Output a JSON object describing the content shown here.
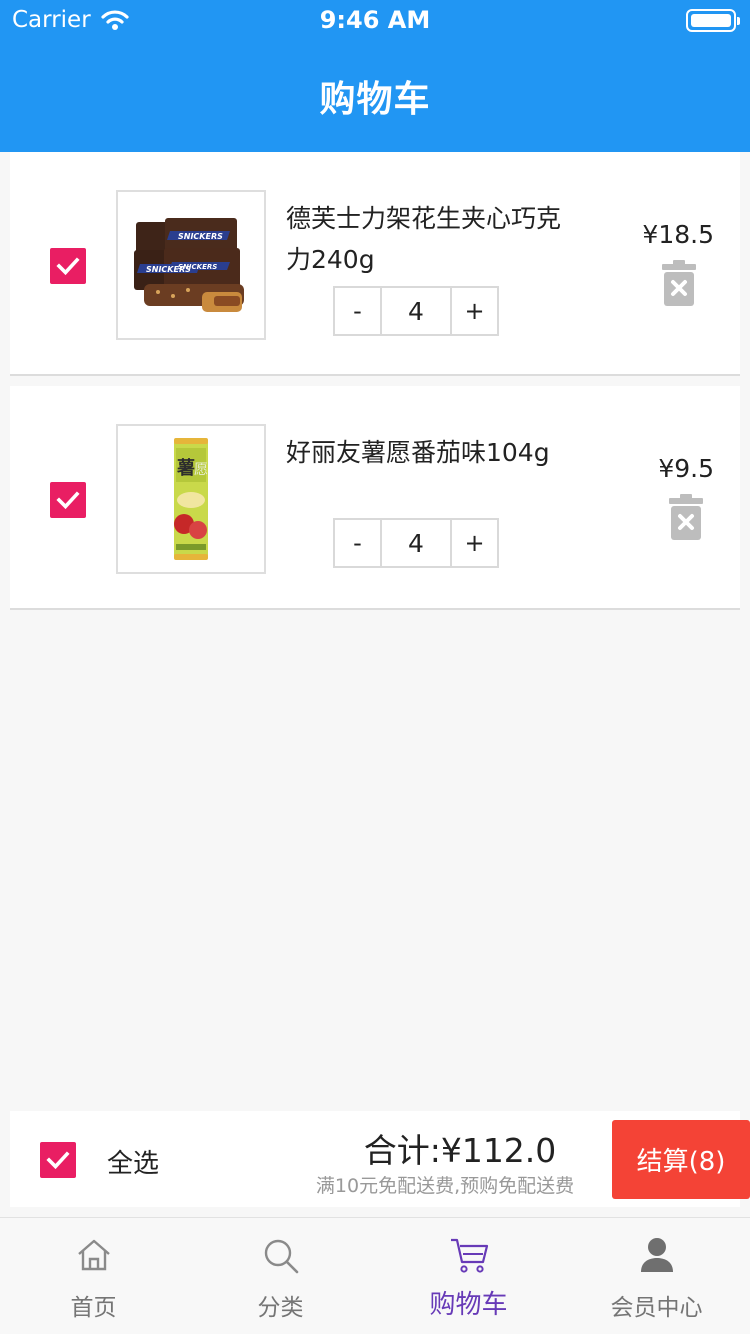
{
  "status_bar": {
    "carrier": "Carrier",
    "time": "9:46 AM"
  },
  "app_bar": {
    "title": "购物车"
  },
  "cart": {
    "items": [
      {
        "name": "德芙士力架花生夹心巧克力240g",
        "price": "¥18.5",
        "quantity": "4",
        "checked": true,
        "minus": "-",
        "plus": "+"
      },
      {
        "name": "好丽友薯愿番茄味104g",
        "price": "¥9.5",
        "quantity": "4",
        "checked": true,
        "minus": "-",
        "plus": "+"
      }
    ]
  },
  "summary": {
    "select_all_label": "全选",
    "total": "合计:¥112.0",
    "note": "满10元免配送费,预购免配送费",
    "checkout_label": "结算(8)"
  },
  "tab_bar": {
    "tabs": [
      {
        "label": "首页",
        "icon": "home-icon",
        "active": false
      },
      {
        "label": "分类",
        "icon": "search-icon",
        "active": false
      },
      {
        "label": "购物车",
        "icon": "cart-icon",
        "active": true
      },
      {
        "label": "会员中心",
        "icon": "person-icon",
        "active": false
      }
    ]
  },
  "colors": {
    "primary": "#2196f3",
    "checkbox": "#e91e63",
    "checkout": "#f44336",
    "active_tab": "#673ab7"
  }
}
